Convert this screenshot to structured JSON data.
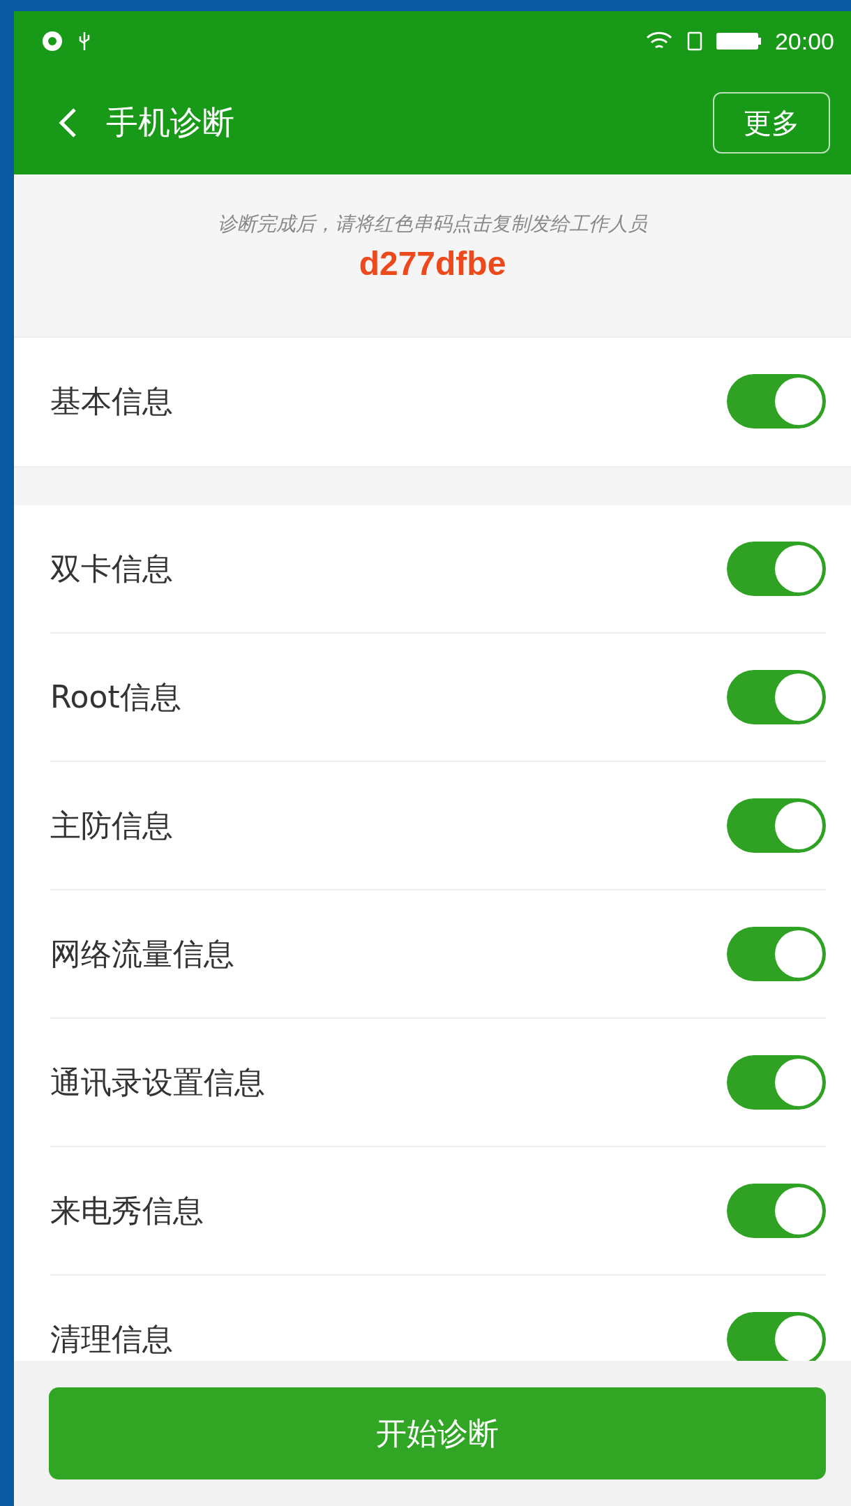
{
  "status_bar": {
    "time": "20:00"
  },
  "header": {
    "title": "手机诊断",
    "more_button": "更多"
  },
  "notice": {
    "hint": "诊断完成后，请将红色串码点击复制发给工作人员",
    "code": "d277dfbe"
  },
  "sections": [
    {
      "items": [
        {
          "label": "基本信息",
          "on": true
        }
      ]
    },
    {
      "items": [
        {
          "label": "双卡信息",
          "on": true
        },
        {
          "label": "Root信息",
          "on": true
        },
        {
          "label": "主防信息",
          "on": true
        },
        {
          "label": "网络流量信息",
          "on": true
        },
        {
          "label": "通讯录设置信息",
          "on": true
        },
        {
          "label": "来电秀信息",
          "on": true
        },
        {
          "label": "清理信息",
          "on": true
        }
      ]
    }
  ],
  "start_button": "开始诊断"
}
